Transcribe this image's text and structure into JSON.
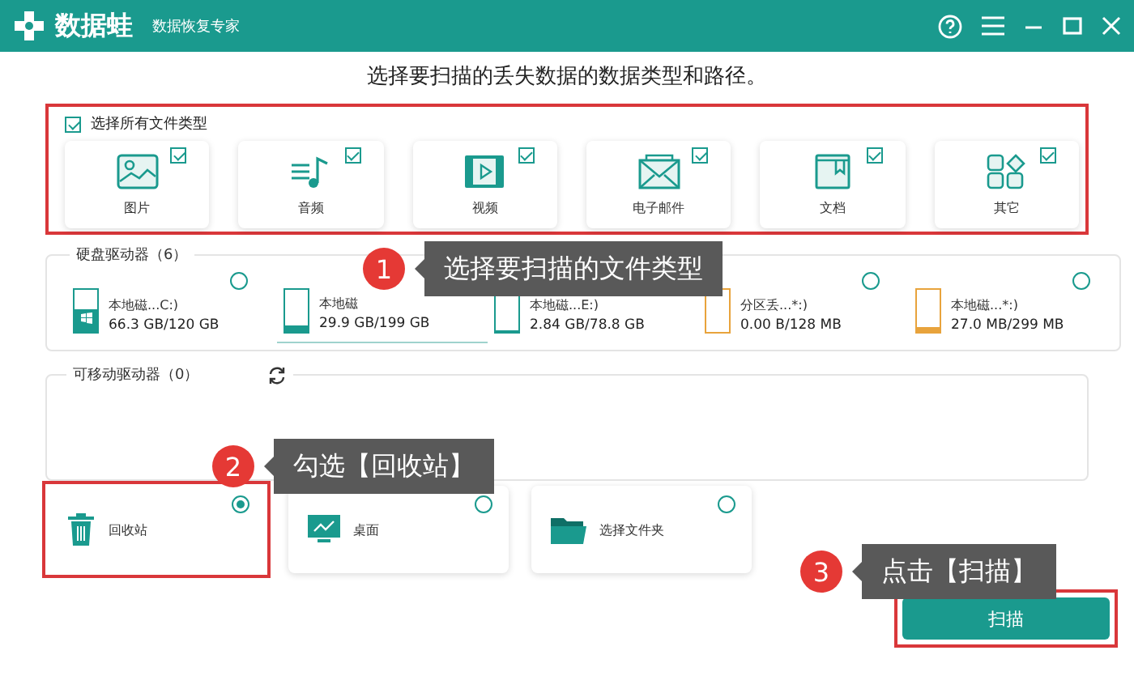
{
  "window": {
    "app_name": "数据蛙",
    "subtitle": "数据恢复专家"
  },
  "heading": "选择要扫描的丢失数据的数据类型和路径。",
  "select_all": {
    "label": "选择所有文件类型",
    "checked": true
  },
  "file_types": [
    {
      "kind": "image",
      "label": "图片",
      "checked": true
    },
    {
      "kind": "audio",
      "label": "音频",
      "checked": true
    },
    {
      "kind": "video",
      "label": "视频",
      "checked": true
    },
    {
      "kind": "email",
      "label": "电子邮件",
      "checked": true
    },
    {
      "kind": "document",
      "label": "文档",
      "checked": true
    },
    {
      "kind": "other",
      "label": "其它",
      "checked": true
    }
  ],
  "hard_drives": {
    "title": "硬盘驱动器（6）",
    "drives": [
      {
        "kind": "system",
        "name": "本地磁...C:)",
        "size": "66.3 GB/120 GB",
        "level": 0.55,
        "color": "#1a9a8e",
        "selected": false
      },
      {
        "kind": "disk",
        "name": "本地磁",
        "size": "29.9 GB/199 GB",
        "level": 0.15,
        "color": "#1a9a8e",
        "selected": true
      },
      {
        "kind": "disk",
        "name": "本地磁...E:)",
        "size": "2.84 GB/78.8 GB",
        "level": 0.05,
        "color": "#1a9a8e",
        "selected": false
      },
      {
        "kind": "disk",
        "name": "分区丢...*:)",
        "size": "0.00  B/128 MB",
        "level": 0,
        "color": "#e8a33c",
        "selected": false
      },
      {
        "kind": "disk",
        "name": "本地磁...*:)",
        "size": "27.0 MB/299 MB",
        "level": 0.12,
        "color": "#e8a33c",
        "selected": false
      }
    ]
  },
  "removable_drives": {
    "title": "可移动驱动器（0）"
  },
  "locations": [
    {
      "kind": "recycle",
      "label": "回收站",
      "selected": true
    },
    {
      "kind": "desktop",
      "label": "桌面",
      "selected": false
    },
    {
      "kind": "folder",
      "label": "选择文件夹",
      "selected": false
    }
  ],
  "scan_button": "扫描",
  "callouts": [
    {
      "number": "1",
      "text": "选择要扫描的文件类型"
    },
    {
      "number": "2",
      "text": "勾选【回收站】"
    },
    {
      "number": "3",
      "text": "点击【扫描】"
    }
  ]
}
